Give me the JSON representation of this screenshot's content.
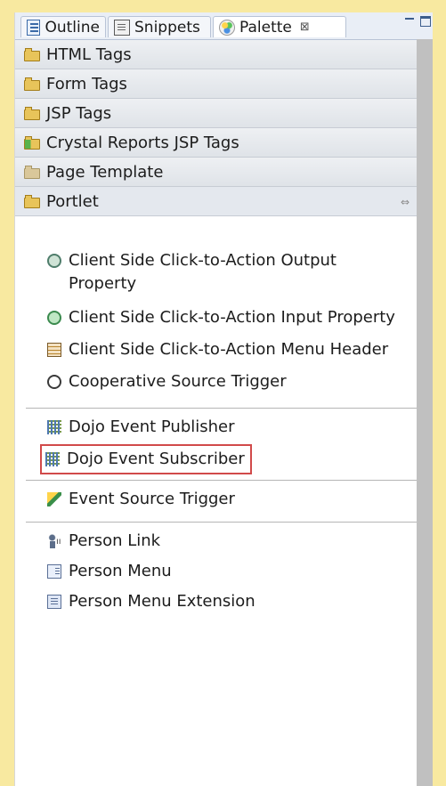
{
  "tabs": [
    {
      "label": "Outline",
      "icon": "outline-icon"
    },
    {
      "label": "Snippets",
      "icon": "snippets-icon"
    },
    {
      "label": "Palette",
      "icon": "palette-icon",
      "active": true,
      "close": "⊠"
    }
  ],
  "drawers": [
    {
      "label": "HTML Tags"
    },
    {
      "label": "Form Tags"
    },
    {
      "label": "JSP Tags"
    },
    {
      "label": "Crystal Reports JSP Tags"
    },
    {
      "label": "Page Template"
    },
    {
      "label": "Portlet",
      "open": true,
      "collapse_icon": "⇔"
    }
  ],
  "items": [
    {
      "label": "Client Side Click-to-Action Output Property",
      "icon": "click-to-action-output-icon"
    },
    {
      "label": "Client Side Click-to-Action Input Property",
      "icon": "click-to-action-input-icon"
    },
    {
      "label": "Client Side Click-to-Action Menu Header",
      "icon": "click-to-action-menu-header-icon"
    },
    {
      "label": "Cooperative Source Trigger",
      "icon": "cooperative-source-trigger-icon"
    },
    {
      "label": "Dojo Event Publisher",
      "icon": "dojo-event-publisher-icon"
    },
    {
      "label": "Dojo Event Subscriber",
      "icon": "dojo-event-subscriber-icon",
      "highlighted": true
    },
    {
      "label": "Event Source Trigger",
      "icon": "event-source-trigger-icon"
    },
    {
      "label": "Person Link",
      "icon": "person-link-icon"
    },
    {
      "label": "Person Menu",
      "icon": "person-menu-icon"
    },
    {
      "label": "Person Menu Extension",
      "icon": "person-menu-extension-icon"
    }
  ],
  "colors": {
    "background": "#f8e9a0",
    "highlight": "#d14a4a",
    "scrollbar": "#c0c0c0"
  }
}
